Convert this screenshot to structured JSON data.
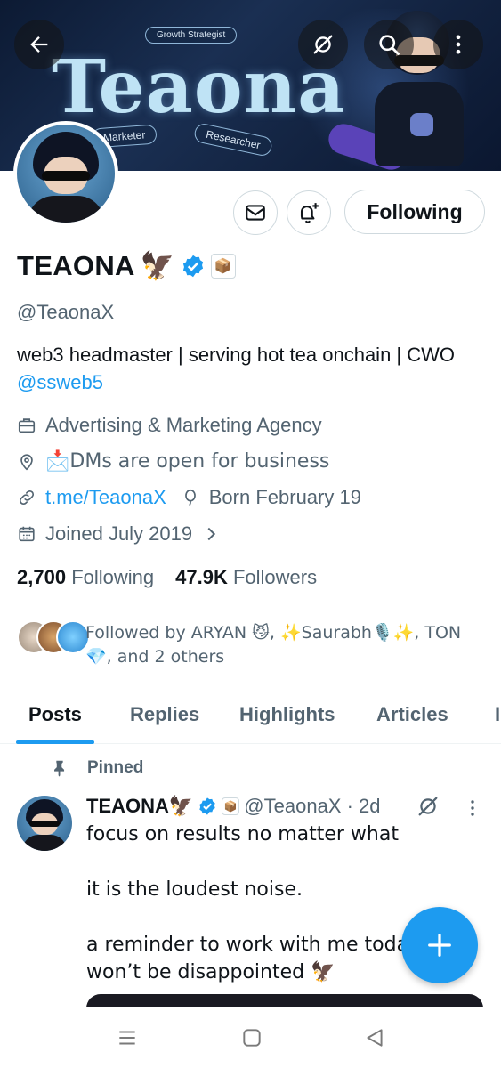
{
  "banner": {
    "word": "Teaona",
    "tags": [
      "Growth Strategist",
      "Marketer",
      "Researcher"
    ]
  },
  "profile": {
    "display_name": "TEAONA",
    "name_emoji": "🦅",
    "affiliate_emoji": "📦",
    "handle": "@TeaonaX",
    "bio_text": "web3 headmaster | serving hot tea onchain | CWO ",
    "bio_link": "@ssweb5",
    "category": "Advertising & Marketing Agency",
    "location": "📩DMs are open for business",
    "website": "t.me/TeaonaX",
    "birthday": "Born February 19",
    "joined": "Joined July 2019",
    "following_count": "2,700",
    "following_label": "Following",
    "followers_count": "47.9K",
    "followers_label": "Followers",
    "followed_by": "Followed by ARYAN 😼, ✨Saurabh🎙️✨, TON 💎, and 2 others"
  },
  "actions": {
    "following_button": "Following"
  },
  "tabs": [
    "Posts",
    "Replies",
    "Highlights",
    "Articles",
    "I"
  ],
  "active_tab": "Posts",
  "post": {
    "pinned_label": "Pinned",
    "author_name": "TEAONA",
    "author_emoji": "🦅",
    "affiliate_emoji": "📦",
    "author_handle": "@TeaonaX · 2d",
    "lines": [
      "focus on results no matter what",
      "it is the loudest noise.",
      "a reminder to work with me today",
      "won’t be disappointed 🦅"
    ]
  },
  "colors": {
    "accent": "#1d9bf0",
    "text_primary": "#0f1419",
    "text_secondary": "#536471",
    "border": "#cfd9de"
  },
  "icons": {
    "back": "arrow-left-icon",
    "grok": "grok-icon",
    "search": "search-icon",
    "more": "more-vertical-icon",
    "mail": "mail-icon",
    "bell": "bell-plus-icon",
    "verified": "verified-badge-icon",
    "category": "briefcase-icon",
    "location": "location-pin-icon",
    "link": "link-icon",
    "birthday": "balloon-icon",
    "calendar": "calendar-icon",
    "pin": "pin-icon",
    "compose": "plus-icon"
  }
}
